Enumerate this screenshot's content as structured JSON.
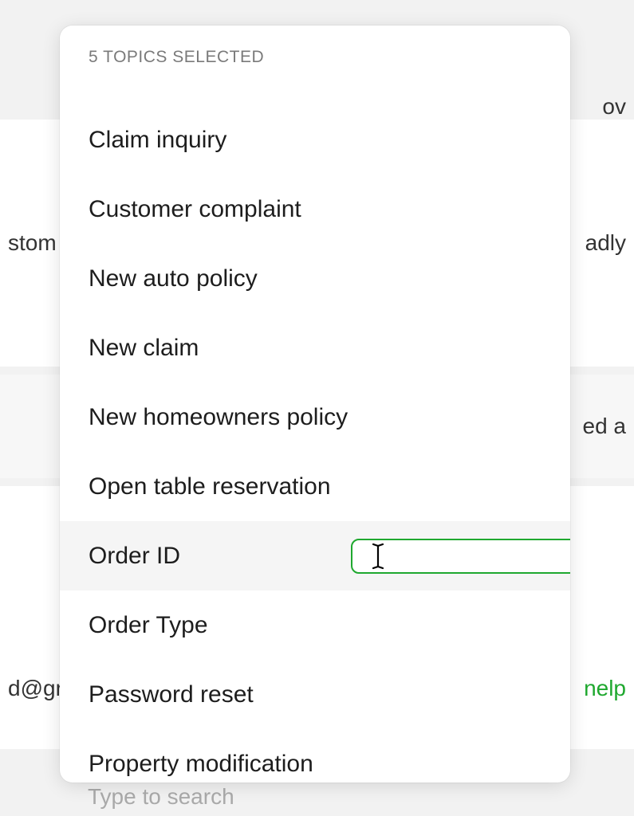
{
  "background": {
    "row1_left": "stom",
    "row1_right": "adly",
    "row0_right": "ov",
    "row2_right": "ed a",
    "row3_left": "d@gr",
    "row3_right": "nelp",
    "search_placeholder": "Type to search"
  },
  "dropdown": {
    "header": "5 TOPICS SELECTED",
    "items": [
      {
        "label": "Claim inquiry"
      },
      {
        "label": "Customer complaint"
      },
      {
        "label": "New auto policy"
      },
      {
        "label": "New claim"
      },
      {
        "label": "New homeowners policy"
      },
      {
        "label": "Open table reservation"
      },
      {
        "label": "Order ID",
        "highlighted": true,
        "has_input": true,
        "input_value": ""
      },
      {
        "label": "Order Type"
      },
      {
        "label": "Password reset"
      },
      {
        "label": "Property modification"
      }
    ]
  }
}
